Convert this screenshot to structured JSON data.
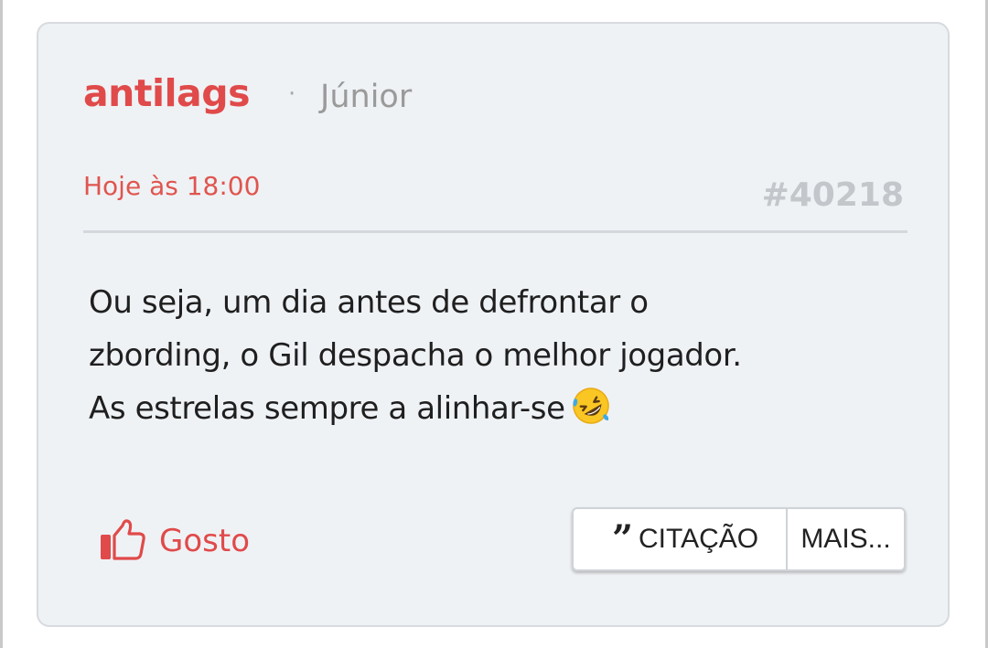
{
  "post": {
    "author": "antilags",
    "separator": "·",
    "rank": "Júnior",
    "timestamp": "Hoje às 18:00",
    "number": "#40218",
    "body_lines": [
      "Ou seja, um dia antes de defrontar o",
      "zbording, o Gil despacha o melhor jogador.",
      "As estrelas sempre a alinhar-se"
    ],
    "emoji": "rolling-on-floor-laughing"
  },
  "actions": {
    "like_label": "Gosto",
    "quote_label": "CITAÇÃO",
    "quote_icon": "quote-icon",
    "more_label": "MAIS..."
  },
  "colors": {
    "accent": "#e04a4a",
    "card_bg": "#eff2f5",
    "muted": "#9a9a9a",
    "post_number": "#c3c6ca"
  }
}
